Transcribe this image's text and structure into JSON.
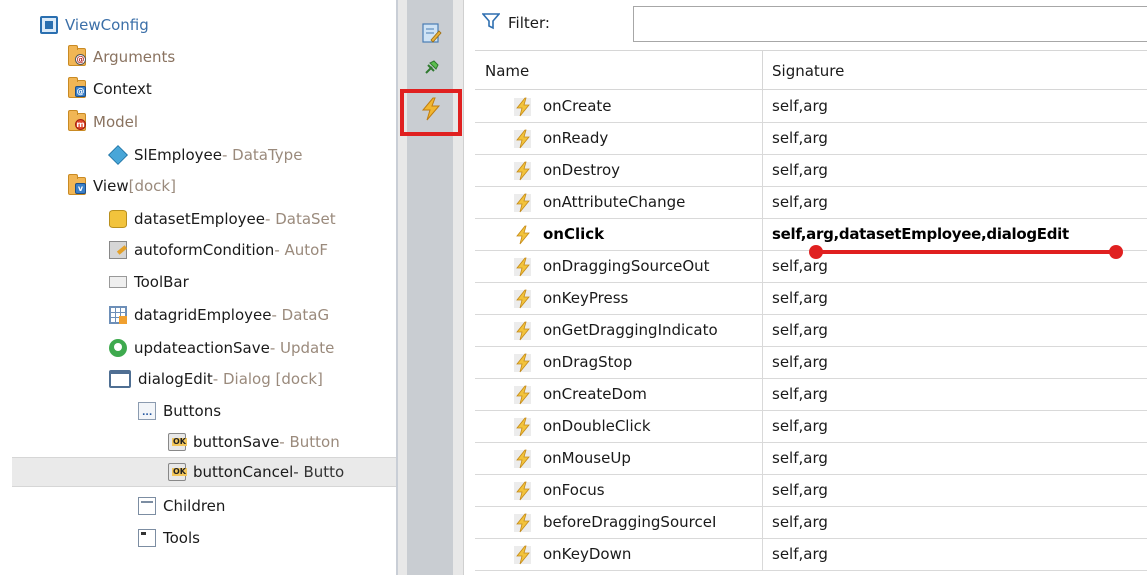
{
  "tree": {
    "items": [
      {
        "name": "ViewConfig",
        "suffix": "",
        "icon": "view-config-icon",
        "dim": false
      },
      {
        "name": "Arguments",
        "suffix": "",
        "icon": "arguments-folder-icon",
        "dim": true
      },
      {
        "name": "Context",
        "suffix": "",
        "icon": "context-folder-icon",
        "dim": false
      },
      {
        "name": "Model",
        "suffix": "",
        "icon": "model-folder-icon",
        "dim": true
      },
      {
        "name": "SlEmployee",
        "suffix": " - DataType",
        "icon": "datatype-cube-icon",
        "dim": false
      },
      {
        "name": "View",
        "suffix": " [dock]",
        "icon": "view-folder-icon",
        "dim": false
      },
      {
        "name": "datasetEmployee",
        "suffix": " - DataSet",
        "icon": "dataset-icon",
        "dim": false
      },
      {
        "name": "autoformCondition",
        "suffix": " - AutoF",
        "icon": "autoform-icon",
        "dim": false
      },
      {
        "name": "ToolBar",
        "suffix": "",
        "icon": "toolbar-icon",
        "dim": false
      },
      {
        "name": "datagridEmployee",
        "suffix": " - DataG",
        "icon": "datagrid-icon",
        "dim": false
      },
      {
        "name": "updateactionSave",
        "suffix": " - Update",
        "icon": "update-action-icon",
        "dim": false
      },
      {
        "name": "dialogEdit",
        "suffix": " - Dialog [dock]",
        "icon": "dialog-icon",
        "dim": false
      },
      {
        "name": "Buttons",
        "suffix": "",
        "icon": "buttons-container-icon",
        "dim": false
      },
      {
        "name": "buttonSave",
        "suffix": " - Button",
        "icon": "ok-button-icon",
        "dim": false
      },
      {
        "name": "buttonCancel",
        "suffix": " - Butto",
        "icon": "ok-button-icon",
        "dim": false
      },
      {
        "name": "Children",
        "suffix": "",
        "icon": "children-panel-icon",
        "dim": false
      },
      {
        "name": "Tools",
        "suffix": "",
        "icon": "tools-panel-icon",
        "dim": false
      }
    ],
    "selected": "buttonCancel"
  },
  "toolbar": {
    "buttons": [
      "edit-properties-icon",
      "pin-icon",
      "events-lightning-icon"
    ],
    "active": "events-lightning-icon"
  },
  "filter": {
    "label": "Filter:",
    "value": ""
  },
  "events_table": {
    "headers": {
      "name": "Name",
      "signature": "Signature"
    },
    "rows": [
      {
        "name": "onCreate",
        "signature": "self,arg"
      },
      {
        "name": "onReady",
        "signature": "self,arg"
      },
      {
        "name": "onDestroy",
        "signature": "self,arg"
      },
      {
        "name": "onAttributeChange",
        "signature": "self,arg"
      },
      {
        "name": "onClick",
        "signature": "self,arg,datasetEmployee,dialogEdit"
      },
      {
        "name": "onDraggingSourceOut",
        "signature": "self,arg"
      },
      {
        "name": "onKeyPress",
        "signature": "self,arg"
      },
      {
        "name": "onGetDraggingIndicato",
        "signature": "self,arg"
      },
      {
        "name": "onDragStop",
        "signature": "self,arg"
      },
      {
        "name": "onCreateDom",
        "signature": "self,arg"
      },
      {
        "name": "onDoubleClick",
        "signature": "self,arg"
      },
      {
        "name": "onMouseUp",
        "signature": "self,arg"
      },
      {
        "name": "onFocus",
        "signature": "self,arg"
      },
      {
        "name": "beforeDraggingSourceI",
        "signature": "self,arg"
      },
      {
        "name": "onKeyDown",
        "signature": "self,arg"
      }
    ],
    "active_row": "onClick"
  },
  "colors": {
    "annotation": "#e02020",
    "event_icon": "#f2c33c"
  }
}
